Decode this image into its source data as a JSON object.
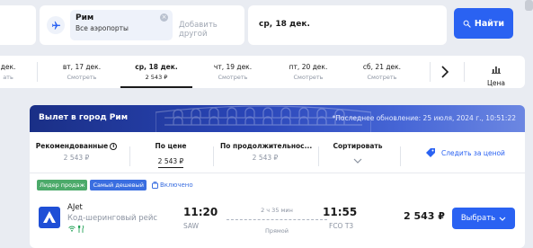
{
  "search": {
    "destination": "Рим",
    "destination_airports": "Все аэропорты",
    "add_other_placeholder": "Добавить другой",
    "date": "ср, 18 дек.",
    "find_button": "Найти"
  },
  "dates": [
    {
      "label": "дек.",
      "sub": "ать"
    },
    {
      "label": "вт, 17 дек.",
      "sub": "Смотреть"
    },
    {
      "label": "ср, 18 дек.",
      "sub": "2 543 ₽",
      "active": true
    },
    {
      "label": "чт, 19 дек.",
      "sub": "Смотреть"
    },
    {
      "label": "пт, 20 дек.",
      "sub": "Смотреть"
    },
    {
      "label": "сб, 21 дек.",
      "sub": "Смотреть"
    }
  ],
  "price_chart_label": "Цена",
  "results": {
    "banner_title": "Вылет в город Рим",
    "banner_note": "*Последнее обновление: 25 июля, 2024 г., 10:51:22",
    "sort_tabs": [
      {
        "name": "Рекомендованные",
        "value": "2 543 ₽"
      },
      {
        "name": "По цене",
        "value": "2 543 ₽",
        "active": true
      },
      {
        "name": "По продолжительнос...",
        "value": "2 543 ₽"
      }
    ],
    "sort_label": "Сортировать",
    "follow_price": "Следить за ценой",
    "flight": {
      "badges": [
        "Лидер продаж",
        "Самый дешевый"
      ],
      "included": "Включено",
      "airline": "AJet",
      "airline_desc": "Код-шеринговый рейс",
      "departure_time": "11:20",
      "departure_airport": "SAW",
      "duration": "2 ч 35 мин",
      "stops": "Прямой",
      "arrival_time": "11:55",
      "arrival_airport": "FCO T3",
      "price": "2 543 ₽",
      "select_button": "Выбрать"
    }
  },
  "colors": {
    "accent": "#2a62f2",
    "banner": "#2a46b8",
    "badge_green": "#4caa6a",
    "badge_blue": "#3a6ee0"
  }
}
